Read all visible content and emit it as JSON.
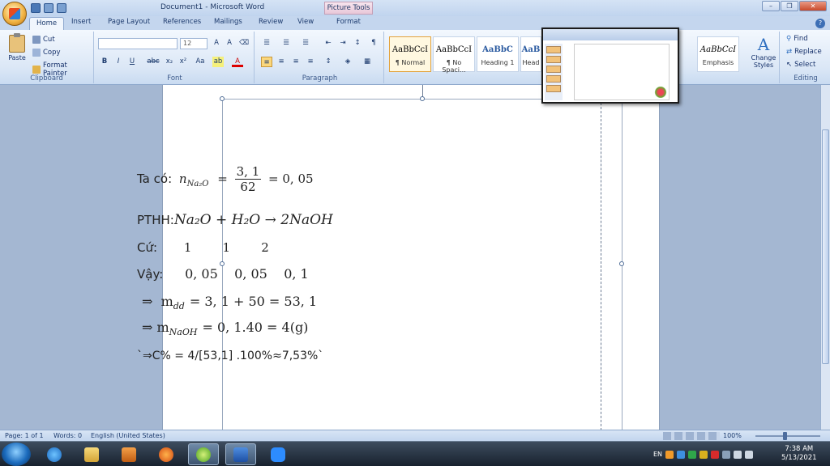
{
  "window": {
    "title": "Document1 - Microsoft Word",
    "context_tab_group": "Picture Tools"
  },
  "tabs": [
    "Home",
    "Insert",
    "Page Layout",
    "References",
    "Mailings",
    "Review",
    "View",
    "Format"
  ],
  "clipboard": {
    "paste": "Paste",
    "cut": "Cut",
    "copy": "Copy",
    "format_painter": "Format Painter",
    "group_label": "Clipboard"
  },
  "font": {
    "font_name": "",
    "font_size": "12",
    "group_label": "Font"
  },
  "paragraph": {
    "group_label": "Paragraph"
  },
  "styles": {
    "items": [
      {
        "preview": "AaBbCcI",
        "name": "¶ Normal"
      },
      {
        "preview": "AaBbCcI",
        "name": "¶ No Spaci..."
      },
      {
        "preview": "AaBbC",
        "name": "Heading 1"
      },
      {
        "preview": "AaB",
        "name": "Head"
      },
      {
        "preview": "AaBbCcI",
        "name": "Emphasis"
      }
    ],
    "change_styles": "Change Styles",
    "group_label": "Styles"
  },
  "editing": {
    "find": "Find",
    "replace": "Replace",
    "select": "Select",
    "group_label": "Editing"
  },
  "document": {
    "line1_prefix": "Ta có:",
    "line1_n": "n",
    "line1_sub": "Na₂O",
    "line1_num": "3, 1",
    "line1_den": "62",
    "line1_result": "= 0, 05",
    "line2_prefix": "PTHH:",
    "line2_eq": "Na₂O + H₂O → 2NaOH",
    "line3_label": "Cứ:",
    "line3_values": "1        1        2",
    "line4_label": "Vậy:",
    "line4_values": "0, 05    0, 05    0, 1",
    "line5": "⇒  m",
    "line5_sub": "dd",
    "line5_rest": "= 3, 1 + 50 = 53, 1",
    "line6": "⇒ m",
    "line6_sub": "NaOH",
    "line6_rest": "= 0, 1.40 = 4(g)",
    "line7": "`⇒C% = 4/[53,1] .100%≈7,53%`"
  },
  "status": {
    "page": "Page: 1 of 1",
    "words": "Words: 0",
    "language": "English (United States)",
    "zoom": "100%"
  },
  "taskbar": {
    "lang": "EN",
    "time": "7:38 AM",
    "date": "5/13/2021"
  }
}
